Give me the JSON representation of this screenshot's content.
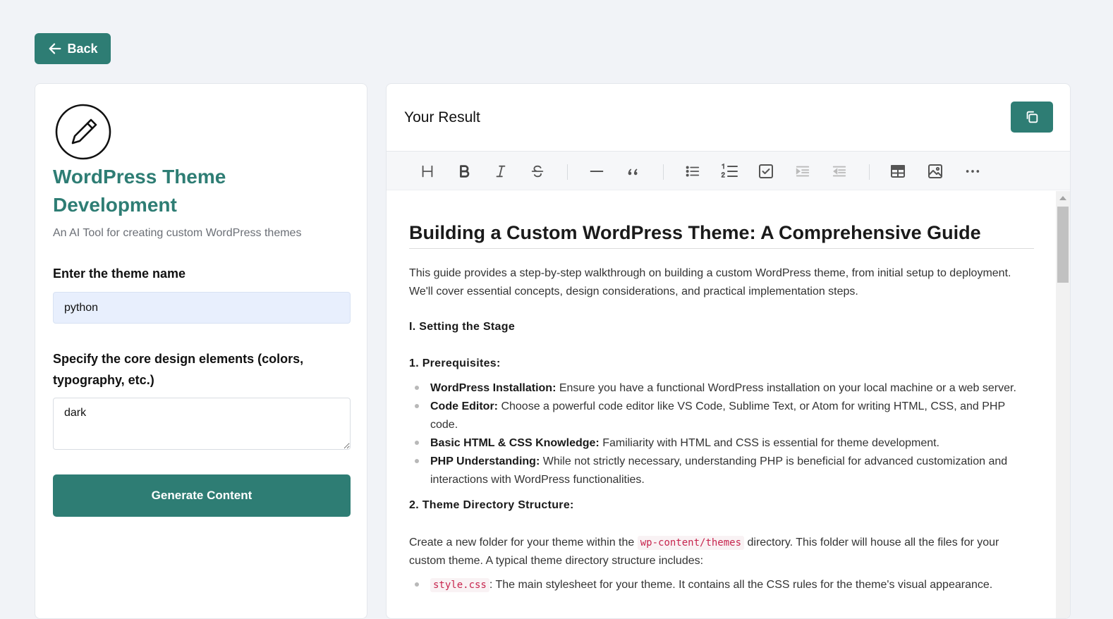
{
  "back_button": {
    "label": "Back"
  },
  "tool": {
    "title": "WordPress Theme Development",
    "subtitle": "An AI Tool for creating custom WordPress themes"
  },
  "form": {
    "theme_name_label": "Enter the theme name",
    "theme_name_value": "python",
    "design_label": "Specify the core design elements (colors, typography, etc.)",
    "design_value": "dark",
    "generate_label": "Generate Content"
  },
  "result": {
    "title": "Your Result"
  },
  "colors": {
    "accent": "#2e7d74",
    "page_bg": "#f1f3f7",
    "input_bg": "#e8effd"
  },
  "toolbar": {
    "items": [
      "heading-icon",
      "bold-icon",
      "italic-icon",
      "strikethrough-icon",
      "horizontal-rule-icon",
      "quote-icon",
      "bullet-list-icon",
      "ordered-list-icon",
      "task-list-icon",
      "indent-icon",
      "outdent-icon",
      "table-icon",
      "image-icon",
      "more-icon"
    ]
  },
  "doc": {
    "h1": "Building a Custom WordPress Theme: A Comprehensive Guide",
    "intro": "This guide provides a step-by-step walkthrough on building a custom WordPress theme, from initial setup to deployment. We'll cover essential concepts, design considerations, and practical implementation steps.",
    "section1": "I. Setting the Stage",
    "sub1": "1. Prerequisites:",
    "prereqs": [
      {
        "term": "WordPress Installation:",
        "text": "Ensure you have a functional WordPress installation on your local machine or a web server."
      },
      {
        "term": "Code Editor:",
        "text": "Choose a powerful code editor like VS Code, Sublime Text, or Atom for writing HTML, CSS, and PHP code."
      },
      {
        "term": "Basic HTML & CSS Knowledge:",
        "text": "Familiarity with HTML and CSS is essential for theme development."
      },
      {
        "term": "PHP Understanding:",
        "text": "While not strictly necessary, understanding PHP is beneficial for advanced customization and interactions with WordPress functionalities."
      }
    ],
    "sub2": "2. Theme Directory Structure:",
    "structure_before": "Create a new folder for your theme within the",
    "structure_code": "wp-content/themes",
    "structure_after": "directory. This folder will house all the files for your custom theme.  A typical theme directory structure includes:",
    "files": [
      {
        "code": "style.css",
        "text": ":  The main stylesheet for your theme. It contains all the CSS rules for the theme's visual appearance."
      }
    ]
  }
}
